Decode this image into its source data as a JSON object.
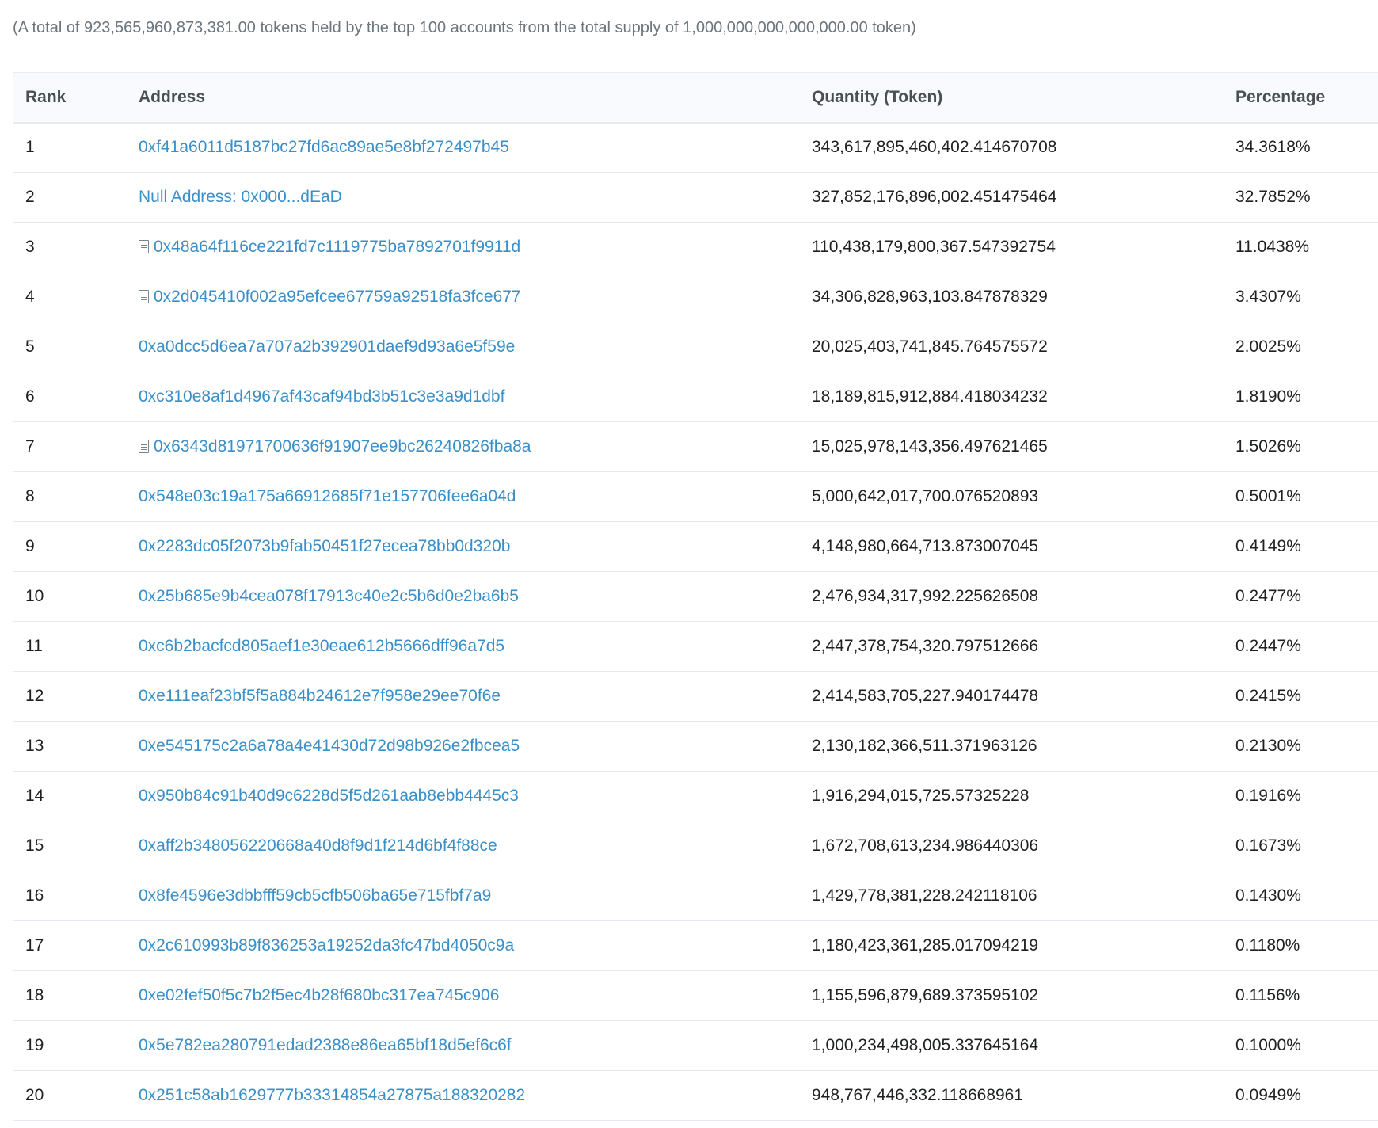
{
  "summary": "(A total of 923,565,960,873,381.00 tokens held by the top 100 accounts from the total supply of 1,000,000,000,000,000.00 token)",
  "table": {
    "headers": {
      "rank": "Rank",
      "address": "Address",
      "quantity": "Quantity (Token)",
      "percentage": "Percentage"
    },
    "rows": [
      {
        "rank": "1",
        "address": "0xf41a6011d5187bc27fd6ac89ae5e8bf272497b45",
        "is_contract": false,
        "quantity": "343,617,895,460,402.414670708",
        "percentage": "34.3618%"
      },
      {
        "rank": "2",
        "address": "Null Address: 0x000...dEaD",
        "is_contract": false,
        "quantity": "327,852,176,896,002.451475464",
        "percentage": "32.7852%"
      },
      {
        "rank": "3",
        "address": "0x48a64f116ce221fd7c1119775ba7892701f9911d",
        "is_contract": true,
        "quantity": "110,438,179,800,367.547392754",
        "percentage": "11.0438%"
      },
      {
        "rank": "4",
        "address": "0x2d045410f002a95efcee67759a92518fa3fce677",
        "is_contract": true,
        "quantity": "34,306,828,963,103.847878329",
        "percentage": "3.4307%"
      },
      {
        "rank": "5",
        "address": "0xa0dcc5d6ea7a707a2b392901daef9d93a6e5f59e",
        "is_contract": false,
        "quantity": "20,025,403,741,845.764575572",
        "percentage": "2.0025%"
      },
      {
        "rank": "6",
        "address": "0xc310e8af1d4967af43caf94bd3b51c3e3a9d1dbf",
        "is_contract": false,
        "quantity": "18,189,815,912,884.418034232",
        "percentage": "1.8190%"
      },
      {
        "rank": "7",
        "address": "0x6343d81971700636f91907ee9bc26240826fba8a",
        "is_contract": true,
        "quantity": "15,025,978,143,356.497621465",
        "percentage": "1.5026%"
      },
      {
        "rank": "8",
        "address": "0x548e03c19a175a66912685f71e157706fee6a04d",
        "is_contract": false,
        "quantity": "5,000,642,017,700.076520893",
        "percentage": "0.5001%"
      },
      {
        "rank": "9",
        "address": "0x2283dc05f2073b9fab50451f27ecea78bb0d320b",
        "is_contract": false,
        "quantity": "4,148,980,664,713.873007045",
        "percentage": "0.4149%"
      },
      {
        "rank": "10",
        "address": "0x25b685e9b4cea078f17913c40e2c5b6d0e2ba6b5",
        "is_contract": false,
        "quantity": "2,476,934,317,992.225626508",
        "percentage": "0.2477%"
      },
      {
        "rank": "11",
        "address": "0xc6b2bacfcd805aef1e30eae612b5666dff96a7d5",
        "is_contract": false,
        "quantity": "2,447,378,754,320.797512666",
        "percentage": "0.2447%"
      },
      {
        "rank": "12",
        "address": "0xe111eaf23bf5f5a884b24612e7f958e29ee70f6e",
        "is_contract": false,
        "quantity": "2,414,583,705,227.940174478",
        "percentage": "0.2415%"
      },
      {
        "rank": "13",
        "address": "0xe545175c2a6a78a4e41430d72d98b926e2fbcea5",
        "is_contract": false,
        "quantity": "2,130,182,366,511.371963126",
        "percentage": "0.2130%"
      },
      {
        "rank": "14",
        "address": "0x950b84c91b40d9c6228d5f5d261aab8ebb4445c3",
        "is_contract": false,
        "quantity": "1,916,294,015,725.57325228",
        "percentage": "0.1916%"
      },
      {
        "rank": "15",
        "address": "0xaff2b348056220668a40d8f9d1f214d6bf4f88ce",
        "is_contract": false,
        "quantity": "1,672,708,613,234.986440306",
        "percentage": "0.1673%"
      },
      {
        "rank": "16",
        "address": "0x8fe4596e3dbbfff59cb5cfb506ba65e715fbf7a9",
        "is_contract": false,
        "quantity": "1,429,778,381,228.242118106",
        "percentage": "0.1430%"
      },
      {
        "rank": "17",
        "address": "0x2c610993b89f836253a19252da3fc47bd4050c9a",
        "is_contract": false,
        "quantity": "1,180,423,361,285.017094219",
        "percentage": "0.1180%"
      },
      {
        "rank": "18",
        "address": "0xe02fef50f5c7b2f5ec4b28f680bc317ea745c906",
        "is_contract": false,
        "quantity": "1,155,596,879,689.373595102",
        "percentage": "0.1156%"
      },
      {
        "rank": "19",
        "address": "0x5e782ea280791edad2388e86ea65bf18d5ef6c6f",
        "is_contract": false,
        "quantity": "1,000,234,498,005.337645164",
        "percentage": "0.1000%"
      },
      {
        "rank": "20",
        "address": "0x251c58ab1629777b33314854a27875a188320282",
        "is_contract": false,
        "quantity": "948,767,446,332.118668961",
        "percentage": "0.0949%"
      }
    ]
  },
  "icons": {
    "contract": "file-text-icon"
  },
  "colors": {
    "link": "#3a8fc8",
    "muted_text": "#6c757e",
    "header_bg": "#f8fafd",
    "border": "#e7eaf3"
  }
}
